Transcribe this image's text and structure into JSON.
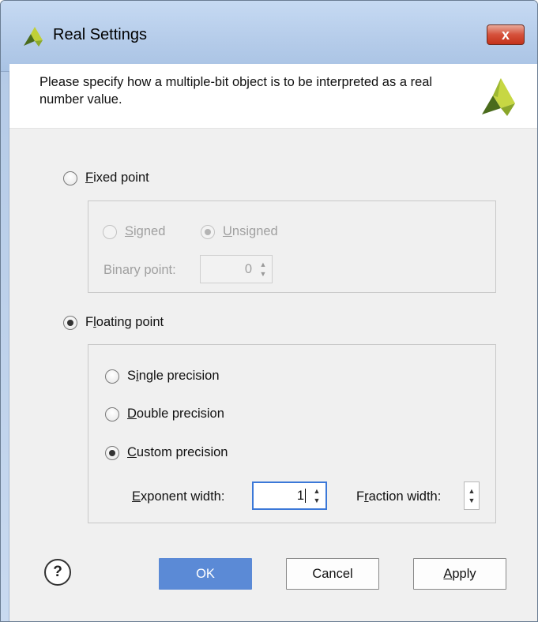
{
  "window": {
    "title": "Real Settings",
    "close_glyph": "x"
  },
  "header": {
    "description": "Please specify how a multiple-bit object is to be interpreted as a real number value."
  },
  "fixed_point": {
    "label_mn": "F",
    "label_rest": "ixed point",
    "checked": false,
    "signed_mn": "S",
    "signed_rest": "igned",
    "unsigned_mn": "U",
    "unsigned_rest": "nsigned",
    "binary_point_label": "Binary point:",
    "binary_point_value": "0"
  },
  "floating_point": {
    "label_pre": "F",
    "label_mn": "l",
    "label_rest": "oating point",
    "checked": true,
    "single_pre": "S",
    "single_mn": "i",
    "single_rest": "ngle precision",
    "double_mn": "D",
    "double_rest": "ouble precision",
    "custom_mn": "C",
    "custom_rest": "ustom precision",
    "selected": "custom",
    "exponent_mn": "E",
    "exponent_rest": "xponent width:",
    "exponent_value": "1",
    "fraction_pre": "F",
    "fraction_mn": "r",
    "fraction_rest": "action width:"
  },
  "buttons": {
    "help": "?",
    "ok": "OK",
    "cancel": "Cancel",
    "apply_mn": "A",
    "apply_rest": "pply"
  },
  "icons": {
    "app": "xilinx-logo-icon",
    "header_logo": "xilinx-logo-icon",
    "spinner_up": "▲",
    "spinner_down": "▼"
  },
  "colors": {
    "accent_button": "#5b8ad6",
    "title_gradient": "#b4cbe9",
    "close_button": "#d5503a",
    "focus_border": "#3b78d8"
  }
}
